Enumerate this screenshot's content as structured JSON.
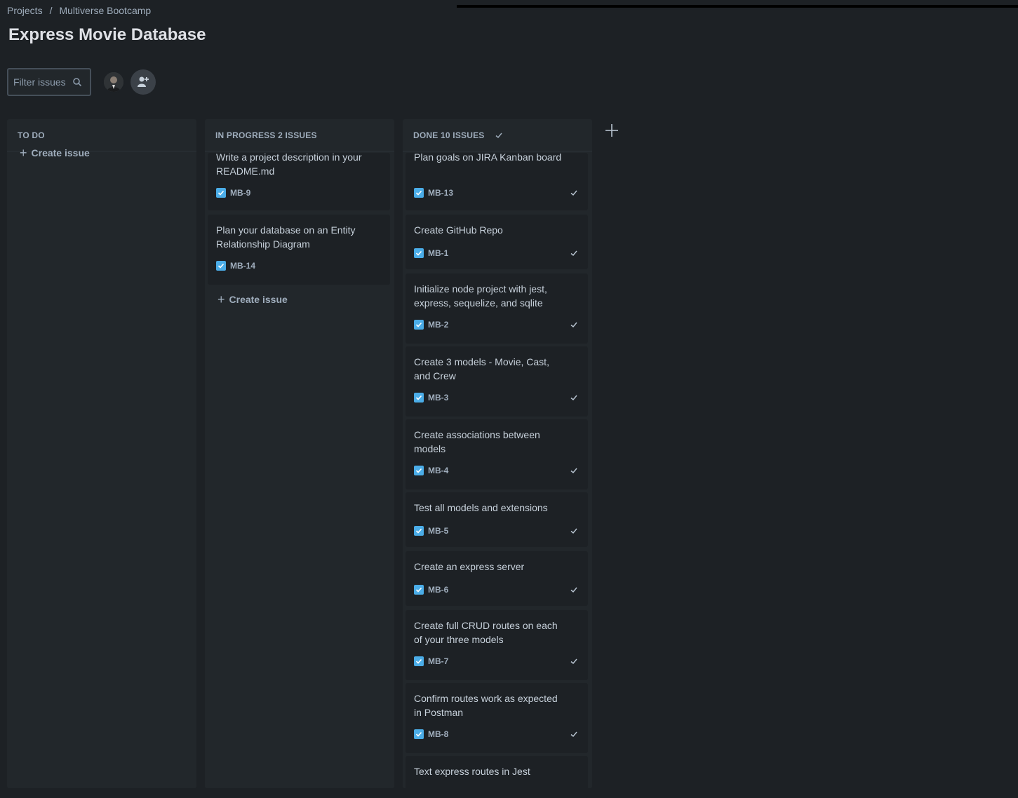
{
  "breadcrumb": {
    "projects": "Projects",
    "separator": "/",
    "project": "Multiverse Bootcamp"
  },
  "page_title": "Express Movie Database",
  "filter": {
    "placeholder": "Filter issues",
    "value": ""
  },
  "columns": {
    "todo": {
      "title": "TO DO",
      "create_label": "Create issue"
    },
    "in_progress": {
      "title": "IN PROGRESS 2 ISSUES",
      "create_label": "Create issue",
      "cards": [
        {
          "summary": "Write a project description in your README.md",
          "key": "MB-9"
        },
        {
          "summary": "Plan your database on an Entity Relationship Diagram",
          "key": "MB-14"
        }
      ]
    },
    "done": {
      "title": "DONE 10 ISSUES",
      "cards": [
        {
          "summary": "Plan goals on JIRA Kanban board",
          "key": "MB-13"
        },
        {
          "summary": "Create GitHub Repo",
          "key": "MB-1"
        },
        {
          "summary": "Initialize node project with jest, express, sequelize, and sqlite",
          "key": "MB-2"
        },
        {
          "summary": "Create 3 models - Movie, Cast, and Crew",
          "key": "MB-3"
        },
        {
          "summary": "Create associations between models",
          "key": "MB-4"
        },
        {
          "summary": "Test all models and extensions",
          "key": "MB-5"
        },
        {
          "summary": "Create an express server",
          "key": "MB-6"
        },
        {
          "summary": "Create full CRUD routes on each of your three models",
          "key": "MB-7"
        },
        {
          "summary": "Confirm routes work as expected in Postman",
          "key": "MB-8"
        },
        {
          "summary": "Text express routes in Jest",
          "key": ""
        }
      ]
    }
  },
  "colors": {
    "background": "#1d2125",
    "column": "#22272b",
    "task_icon": "#4bade8",
    "text": "#c7d1db"
  }
}
